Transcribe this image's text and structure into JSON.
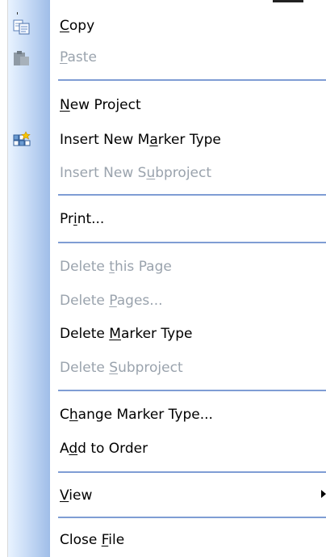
{
  "menu": {
    "items": [
      {
        "key": "copy",
        "pre": "",
        "mn": "C",
        "post": "opy",
        "enabled": true,
        "icon": "copy-icon"
      },
      {
        "key": "paste",
        "pre": "",
        "mn": "P",
        "post": "aste",
        "enabled": false,
        "icon": "paste-icon"
      },
      {
        "key": "new_project",
        "pre": "",
        "mn": "N",
        "post": "ew Project",
        "enabled": true
      },
      {
        "key": "insert_marker",
        "pre": "Insert New M",
        "mn": "a",
        "post": "rker Type",
        "enabled": true,
        "icon": "insert-marker-icon"
      },
      {
        "key": "insert_subproject",
        "pre": "Insert New S",
        "mn": "u",
        "post": "bproject",
        "enabled": false
      },
      {
        "key": "print",
        "pre": "Pr",
        "mn": "i",
        "post": "nt...",
        "enabled": true
      },
      {
        "key": "delete_page",
        "pre": "Delete ",
        "mn": "t",
        "post": "his Page",
        "enabled": false
      },
      {
        "key": "delete_pages",
        "pre": "Delete ",
        "mn": "P",
        "post": "ages...",
        "enabled": false
      },
      {
        "key": "delete_marker",
        "pre": "Delete ",
        "mn": "M",
        "post": "arker Type",
        "enabled": true
      },
      {
        "key": "delete_subproject",
        "pre": "Delete ",
        "mn": "S",
        "post": "ubproject",
        "enabled": false
      },
      {
        "key": "change_marker",
        "pre": "C",
        "mn": "h",
        "post": "ange Marker Type...",
        "enabled": true
      },
      {
        "key": "add_order",
        "pre": "A",
        "mn": "d",
        "post": "d to Order",
        "enabled": true
      },
      {
        "key": "view",
        "pre": "",
        "mn": "V",
        "post": "iew",
        "enabled": true,
        "submenu": true
      },
      {
        "key": "close_file",
        "pre": "Close ",
        "mn": "F",
        "post": "ile",
        "enabled": true
      }
    ]
  },
  "colors": {
    "gutter_light": "#e9f3ff",
    "gutter_dark": "#9fbde8",
    "separator": "#7f9dd4",
    "disabled_text": "#9aa3ad"
  }
}
